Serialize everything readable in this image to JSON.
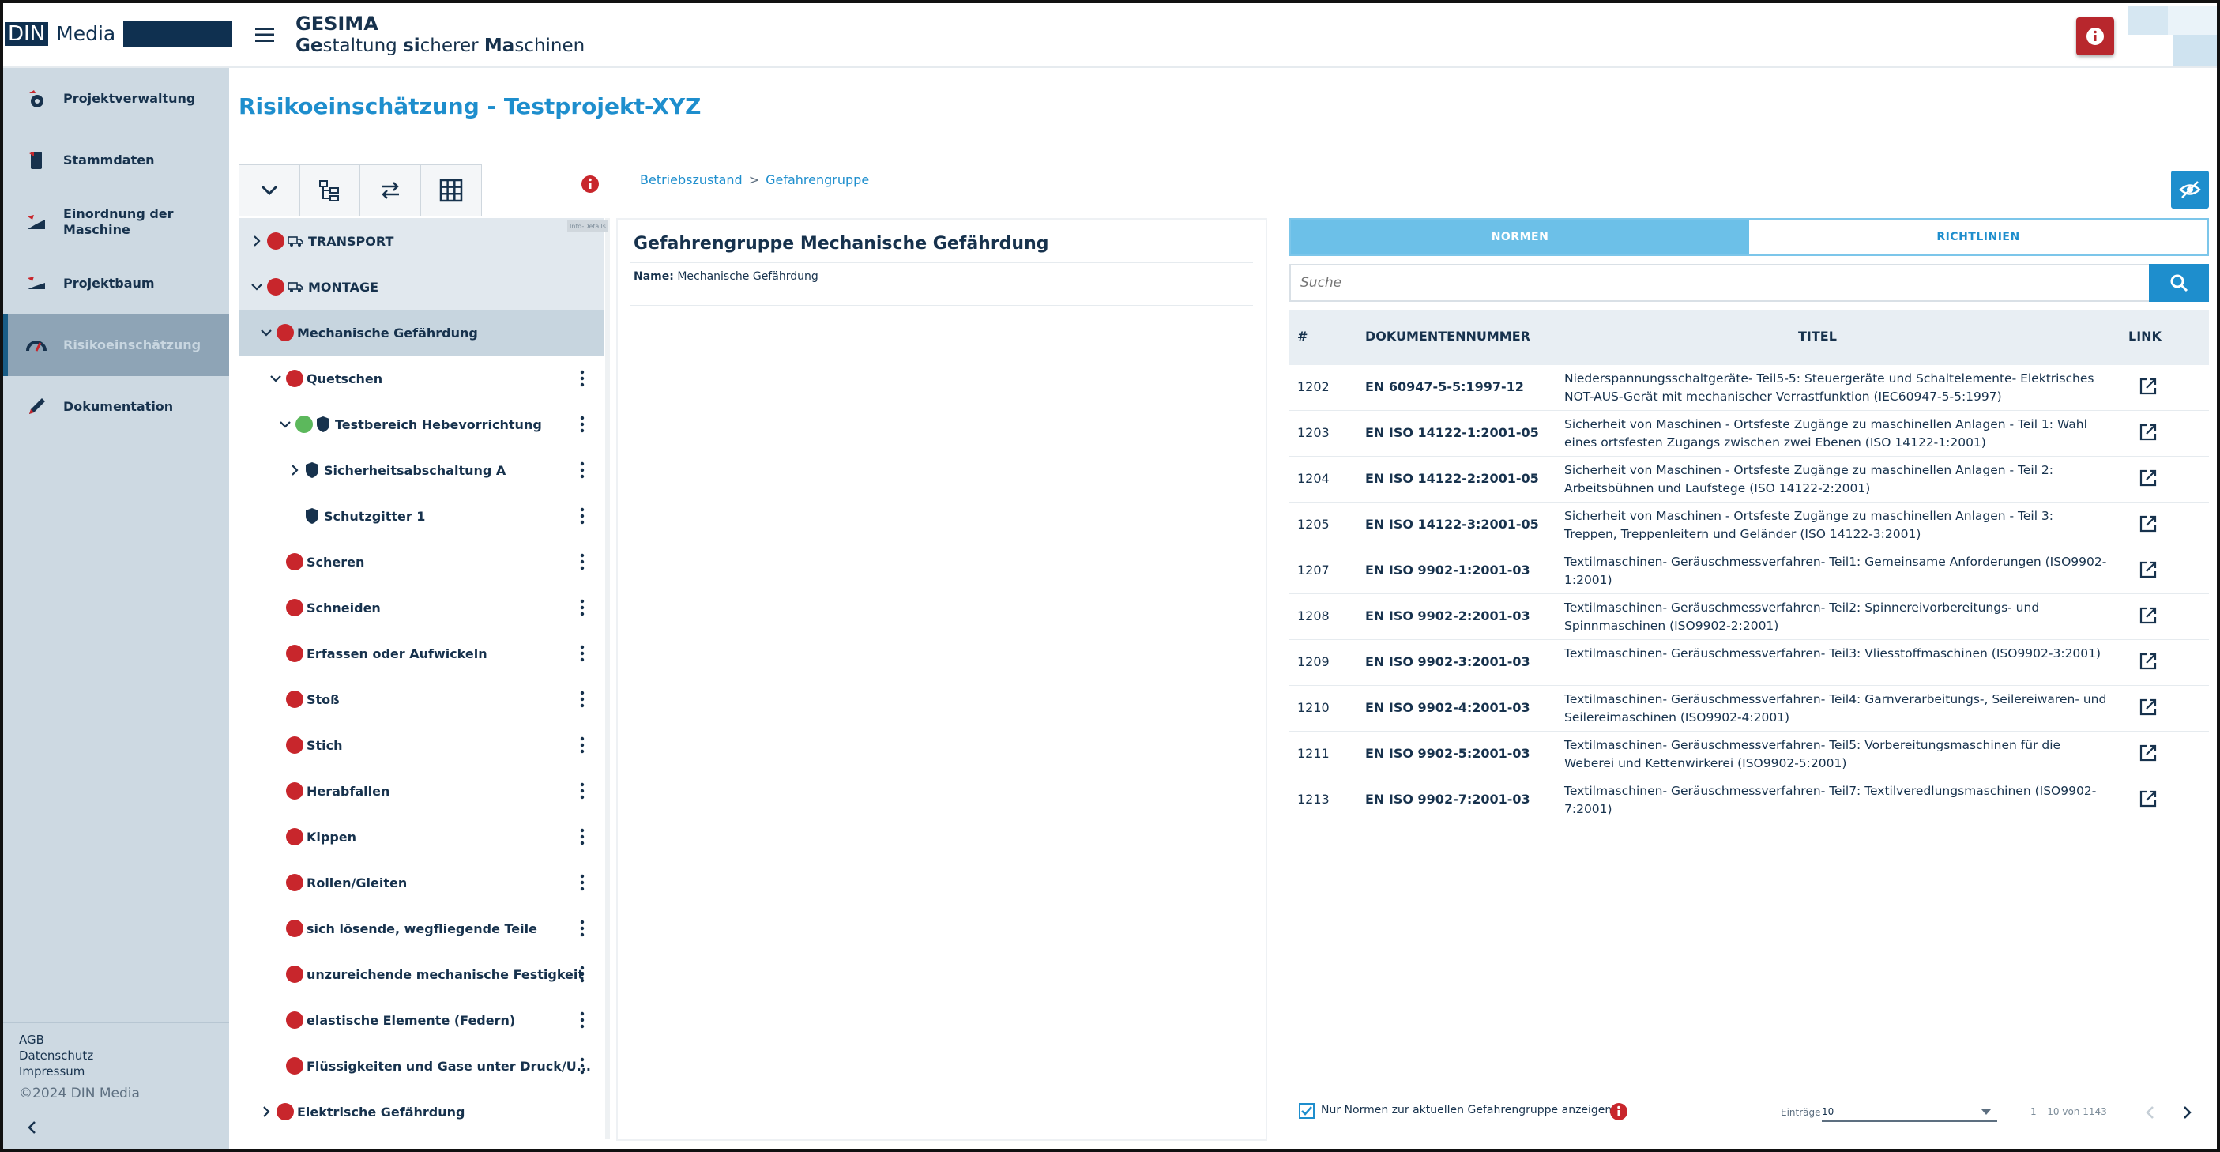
{
  "header": {
    "logo_din": "DIN",
    "logo_media": "Media",
    "app_name": "GESIMA",
    "subtitle_parts": [
      {
        "text": "Ge",
        "bold": true
      },
      {
        "text": "staltung ",
        "bold": false
      },
      {
        "text": "si",
        "bold": true
      },
      {
        "text": "cherer ",
        "bold": false
      },
      {
        "text": "Ma",
        "bold": true
      },
      {
        "text": "schinen",
        "bold": false
      }
    ]
  },
  "sidebar": {
    "items": [
      {
        "label": "Projektverwaltung",
        "icon": "project-gear-icon"
      },
      {
        "label": "Stammdaten",
        "icon": "master-data-icon"
      },
      {
        "label": "Einordnung der Maschine",
        "icon": "machine-classification-icon"
      },
      {
        "label": "Projektbaum",
        "icon": "project-tree-icon"
      },
      {
        "label": "Risikoeinschätzung",
        "icon": "risk-gauge-icon",
        "active": true
      },
      {
        "label": "Dokumentation",
        "icon": "documentation-pen-icon"
      }
    ],
    "footer": {
      "agb": "AGB",
      "datenschutz": "Datenschutz",
      "impressum": "Impressum",
      "copyright": "©2024 DIN Media"
    }
  },
  "page": {
    "title": "Risikoeinschätzung - Testprojekt-XYZ",
    "toolbar_icons": [
      "chevron-down-icon",
      "tree-structure-icon",
      "swap-arrows-icon",
      "grid-table-icon"
    ],
    "tree_tag": "Info-Details"
  },
  "breadcrumb": {
    "items": [
      "Betriebszustand",
      "Gefahrengruppe"
    ],
    "separator": ">"
  },
  "tree": [
    {
      "label": "TRANSPORT",
      "level": 0,
      "chevron": "right",
      "dots": [
        "red"
      ],
      "truck": true,
      "highlight": "light",
      "kebab": false
    },
    {
      "label": "MONTAGE",
      "level": 0,
      "chevron": "down",
      "dots": [
        "red"
      ],
      "truck": true,
      "highlight": "light",
      "kebab": false
    },
    {
      "label": "Mechanische Gefährdung",
      "level": 1,
      "chevron": "down",
      "dots": [
        "red"
      ],
      "highlight": "selected",
      "kebab": false
    },
    {
      "label": "Quetschen",
      "level": 2,
      "chevron": "down",
      "dots": [
        "red"
      ],
      "kebab": true
    },
    {
      "label": "Testbereich Hebevorrichtung",
      "level": 3,
      "chevron": "down",
      "dots": [
        "green"
      ],
      "shield": true,
      "kebab": true
    },
    {
      "label": "Sicherheitsabschaltung A",
      "level": 4,
      "chevron": "right",
      "shield": true,
      "kebab": true
    },
    {
      "label": "Schutzgitter 1",
      "level": 4,
      "chevron": "none",
      "shield": true,
      "kebab": true
    },
    {
      "label": "Scheren",
      "level": 2,
      "chevron": "none",
      "dots": [
        "red"
      ],
      "kebab": true
    },
    {
      "label": "Schneiden",
      "level": 2,
      "chevron": "none",
      "dots": [
        "red"
      ],
      "kebab": true
    },
    {
      "label": "Erfassen oder Aufwickeln",
      "level": 2,
      "chevron": "none",
      "dots": [
        "red"
      ],
      "kebab": true
    },
    {
      "label": "Stoß",
      "level": 2,
      "chevron": "none",
      "dots": [
        "red"
      ],
      "kebab": true
    },
    {
      "label": "Stich",
      "level": 2,
      "chevron": "none",
      "dots": [
        "red"
      ],
      "kebab": true
    },
    {
      "label": "Herabfallen",
      "level": 2,
      "chevron": "none",
      "dots": [
        "red"
      ],
      "kebab": true
    },
    {
      "label": "Kippen",
      "level": 2,
      "chevron": "none",
      "dots": [
        "red"
      ],
      "kebab": true
    },
    {
      "label": "Rollen/Gleiten",
      "level": 2,
      "chevron": "none",
      "dots": [
        "red"
      ],
      "kebab": true
    },
    {
      "label": "sich lösende, wegfliegende Teile",
      "level": 2,
      "chevron": "none",
      "dots": [
        "red"
      ],
      "kebab": true
    },
    {
      "label": "unzureichende mechanische Festigkeit",
      "level": 2,
      "chevron": "none",
      "dots": [
        "red"
      ],
      "kebab": true
    },
    {
      "label": "elastische Elemente (Federn)",
      "level": 2,
      "chevron": "none",
      "dots": [
        "red"
      ],
      "kebab": true
    },
    {
      "label": "Flüssigkeiten und Gase unter Druck/U...",
      "level": 2,
      "chevron": "none",
      "dots": [
        "red"
      ],
      "kebab": true
    },
    {
      "label": "Elektrische Gefährdung",
      "level": 1,
      "chevron": "right",
      "dots": [
        "red"
      ],
      "kebab": false
    }
  ],
  "detail": {
    "title": "Gefahrengruppe Mechanische Gefährdung",
    "name_label": "Name:",
    "name_value": "Mechanische Gefährdung"
  },
  "norms": {
    "tabs": [
      {
        "label": "NORMEN",
        "active": true
      },
      {
        "label": "RICHTLINIEN",
        "active": false
      }
    ],
    "search_placeholder": "Suche",
    "columns": {
      "num": "#",
      "doc": "DOKUMENTENNUMMER",
      "title": "TITEL",
      "link": "LINK"
    },
    "rows": [
      {
        "num": "1202",
        "doc": "EN 60947-5-5:1997-12",
        "title": "Niederspannungsschaltgeräte- Teil5-5: Steuergeräte und Schaltelemente- Elektrisches NOT-AUS-Gerät mit mechanischer Verrastfunktion (IEC60947-5-5:1997)"
      },
      {
        "num": "1203",
        "doc": "EN ISO 14122-1:2001-05",
        "title": "Sicherheit von Maschinen - Ortsfeste Zugänge zu maschinellen Anlagen - Teil 1: Wahl eines ortsfesten Zugangs zwischen zwei Ebenen (ISO 14122-1:2001)"
      },
      {
        "num": "1204",
        "doc": "EN ISO 14122-2:2001-05",
        "title": "Sicherheit von Maschinen - Ortsfeste Zugänge zu maschinellen Anlagen - Teil 2: Arbeitsbühnen und Laufstege (ISO 14122-2:2001)"
      },
      {
        "num": "1205",
        "doc": "EN ISO 14122-3:2001-05",
        "title": "Sicherheit von Maschinen - Ortsfeste Zugänge zu maschinellen Anlagen - Teil 3: Treppen, Treppenleitern und Geländer (ISO 14122-3:2001)"
      },
      {
        "num": "1207",
        "doc": "EN ISO 9902-1:2001-03",
        "title": "Textilmaschinen- Geräuschmessverfahren- Teil1: Gemeinsame Anforderungen (ISO9902-1:2001)"
      },
      {
        "num": "1208",
        "doc": "EN ISO 9902-2:2001-03",
        "title": "Textilmaschinen- Geräuschmessverfahren- Teil2: Spinnereivorbereitungs- und Spinnmaschinen (ISO9902-2:2001)"
      },
      {
        "num": "1209",
        "doc": "EN ISO 9902-3:2001-03",
        "title": "Textilmaschinen- Geräuschmessverfahren- Teil3: Vliesstoffmaschinen (ISO9902-3:2001)"
      },
      {
        "num": "1210",
        "doc": "EN ISO 9902-4:2001-03",
        "title": "Textilmaschinen- Geräuschmessverfahren- Teil4: Garnverarbeitungs-, Seilereiwaren- und Seilereimaschinen (ISO9902-4:2001)"
      },
      {
        "num": "1211",
        "doc": "EN ISO 9902-5:2001-03",
        "title": "Textilmaschinen- Geräuschmessverfahren- Teil5: Vorbereitungsmaschinen für die Weberei und Kettenwirkerei (ISO9902-5:2001)"
      },
      {
        "num": "1213",
        "doc": "EN ISO 9902-7:2001-03",
        "title": "Textilmaschinen- Geräuschmessverfahren- Teil7: Textilveredlungsmaschinen (ISO9902-7:2001)"
      }
    ],
    "footer": {
      "checkbox_label": "Nur Normen zur aktuellen Gefahrengruppe anzeigen.",
      "checkbox_checked": true,
      "entries_label": "Einträge",
      "entries_value": "10",
      "range": "1 – 10 von 1143"
    }
  },
  "colors": {
    "accent": "#1e8ecd",
    "navy": "#0f3050",
    "sidebar": "#cdd9e2",
    "danger": "#c8262c",
    "ok": "#5cb85c"
  }
}
